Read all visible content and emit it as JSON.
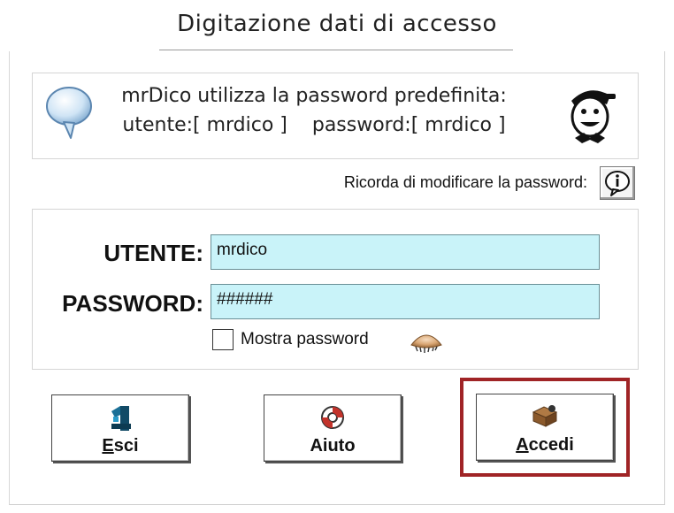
{
  "window": {
    "title": "Digitazione dati di accesso"
  },
  "info": {
    "line1": "mrDico utilizza la password predefinita:",
    "line2": "utente:[ mrdico ]    password:[ mrdico ]"
  },
  "reminder": {
    "label": "Ricorda di modificare la password:"
  },
  "login": {
    "user_label": "UTENTE:",
    "user_value": "mrdico",
    "password_label": "PASSWORD:",
    "password_value": "######",
    "show_password_label": "Mostra password",
    "show_password_checked": false
  },
  "buttons": {
    "exit": {
      "label_first": "E",
      "label_rest": "sci"
    },
    "help": {
      "label": "Aiuto"
    },
    "login": {
      "label_first": "A",
      "label_rest": "ccedi"
    }
  },
  "colors": {
    "field_bg": "#c9f3f9",
    "highlight": "#a02426"
  },
  "icons": {
    "bubble": "speech-bubble-icon",
    "mascot": "mascot-face-icon",
    "info": "info-icon",
    "eye": "eye-icon",
    "exit": "exit-icon",
    "help": "lifebuoy-icon",
    "login": "login-key-icon"
  }
}
